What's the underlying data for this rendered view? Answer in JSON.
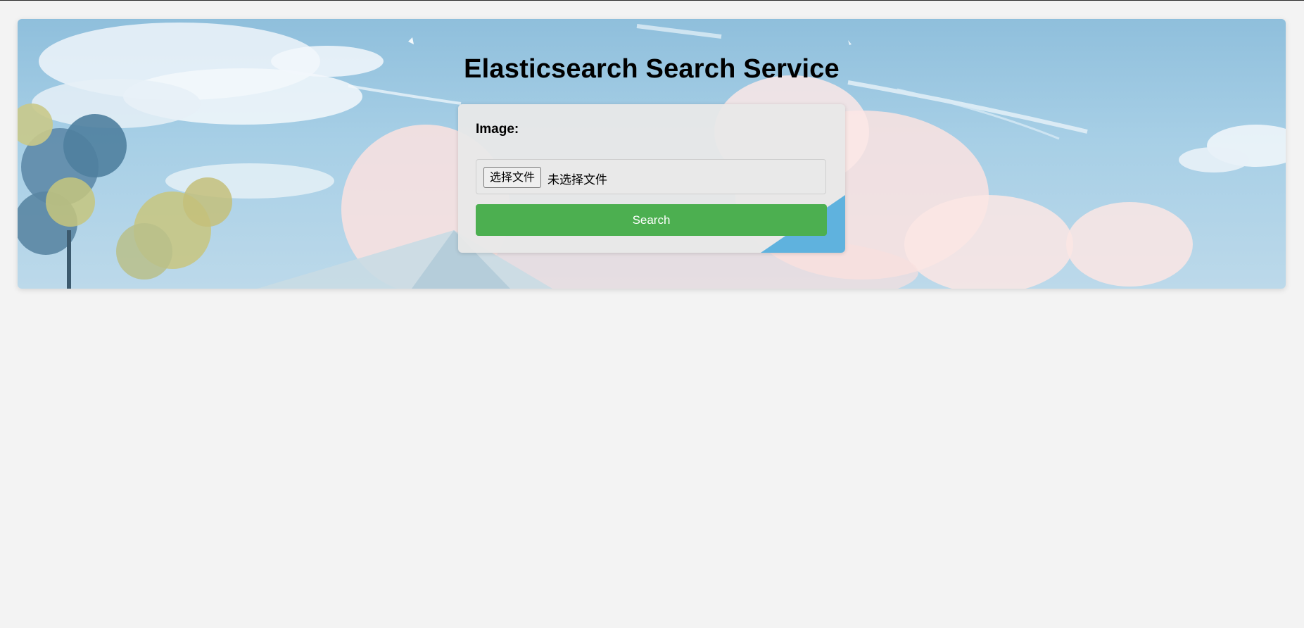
{
  "header": {
    "title": "Elasticsearch Search Service"
  },
  "form": {
    "image_label": "Image:",
    "file_button_label": "选择文件",
    "file_status": "未选择文件",
    "search_label": "Search"
  },
  "colors": {
    "page_background": "#f3f3f3",
    "search_button": "#4caf50",
    "search_button_text": "#ffffff",
    "form_card": "#e8e8e8"
  },
  "icons": [
    "hero-background-illustration"
  ]
}
